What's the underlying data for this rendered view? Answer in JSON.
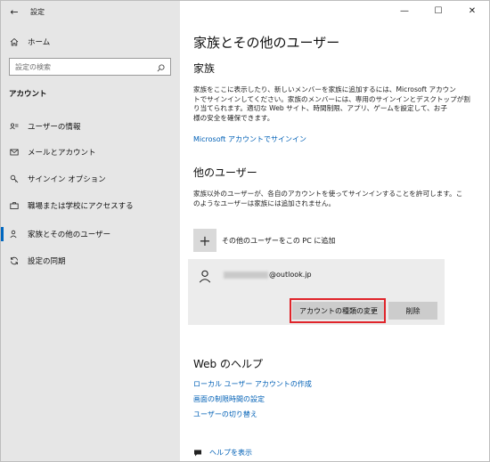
{
  "window": {
    "title": "設定"
  },
  "titlebar": {
    "back_glyph": "←",
    "minimize_glyph": "—",
    "maximize_glyph": "☐",
    "close_glyph": "✕"
  },
  "sidebar": {
    "home_label": "ホーム",
    "search_placeholder": "設定の検索",
    "section_label": "アカウント",
    "items": [
      {
        "label": "ユーザーの情報",
        "icon": "user-card-icon"
      },
      {
        "label": "メールとアカウント",
        "icon": "mail-icon"
      },
      {
        "label": "サインイン オプション",
        "icon": "key-icon"
      },
      {
        "label": "職場または学校にアクセスする",
        "icon": "briefcase-icon"
      },
      {
        "label": "家族とその他のユーザー",
        "icon": "people-icon",
        "active": true
      },
      {
        "label": "設定の同期",
        "icon": "sync-icon"
      }
    ]
  },
  "main": {
    "page_title": "家族とその他のユーザー",
    "family": {
      "heading": "家族",
      "desc_lines": [
        "家族をここに表示したり、新しいメンバーを家族に追加するには、Microsoft アカウン",
        "トでサインインしてください。家族のメンバーには、専用のサインインとデスクトップが割",
        "り当てられます。適切な Web サイト、時間制限、アプリ、ゲームを設定して、お子",
        "様の安全を確保できます。"
      ],
      "signin_link": "Microsoft アカウントでサインイン"
    },
    "other_users": {
      "heading": "他のユーザー",
      "desc_lines": [
        "家族以外のユーザーが、各自のアカウントを使ってサインインすることを許可します。こ",
        "のようなユーザーは家族には追加されません。"
      ],
      "add_label": "その他のユーザーをこの PC に追加",
      "add_glyph": "+",
      "user_email_suffix": "@outlook.jp",
      "change_type_button": "アカウントの種類の変更",
      "remove_button": "削除"
    },
    "help": {
      "heading": "Web のヘルプ",
      "links": [
        "ローカル ユーザー アカウントの作成",
        "画面の制限時間の設定",
        "ユーザーの切り替え"
      ],
      "show_help": "ヘルプを表示"
    }
  },
  "colors": {
    "accent": "#0067c0",
    "link": "#0060b6",
    "highlight": "#e0242a",
    "sidebar_bg": "#e6e6e6"
  }
}
